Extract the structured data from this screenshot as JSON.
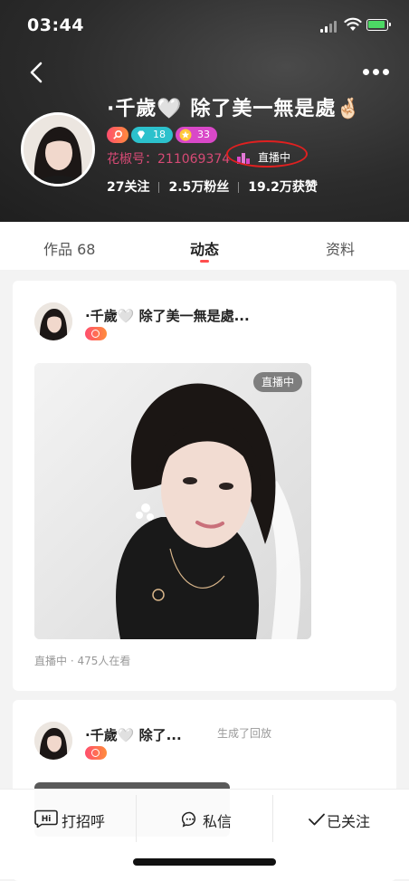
{
  "status_bar": {
    "time": "03:44"
  },
  "profile": {
    "nickname": "·千歲🤍 除了美一無是處🤞🏻",
    "badges": {
      "diamond_level": "18",
      "star_level": "33"
    },
    "id_text": "花椒号：211069374",
    "live_tag": "直播中",
    "stats": {
      "following": "27关注",
      "fans": "2.5万粉丝",
      "likes": "19.2万获赞"
    }
  },
  "tabs": [
    {
      "label": "作品 68"
    },
    {
      "label": "动态"
    },
    {
      "label": "资料"
    }
  ],
  "feed": [
    {
      "name": "·千歲🤍 除了美一無是處...",
      "live_chip": "直播中",
      "footnote": "直播中 · 475人在看"
    },
    {
      "name": "·千歲🤍 除了...",
      "action": "生成了回放"
    }
  ],
  "bottom_bar": {
    "greet_badge": "Hi",
    "greet": "打招呼",
    "message": "私信",
    "followed": "已关注"
  },
  "colors": {
    "accent_red": "#ff4e4e",
    "id_pink": "#d74a75",
    "diamond_teal": "#2cc1cc",
    "star_purple": "#d948c8",
    "annotation_red": "#e02020"
  },
  "icons": [
    "back-arrow-icon",
    "more-dots-icon",
    "signal-icon",
    "wifi-icon",
    "battery-icon",
    "diamond-icon",
    "star-icon",
    "live-bars-icon",
    "chat-bubble-icon",
    "check-icon",
    "hi-icon"
  ]
}
